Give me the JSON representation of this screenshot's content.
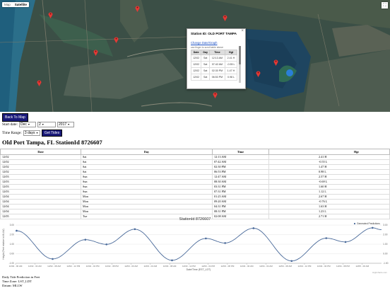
{
  "map": {
    "type_buttons": [
      "Map",
      "Satellite"
    ],
    "selected_type": "Satellite",
    "popup": {
      "title": "Station ID: OLD PORT TAMPA",
      "close": "×",
      "change_link": "Change Date/Graph",
      "hint": "use finger to scroll table above",
      "headers": [
        "Date",
        "Day",
        "Time",
        "Hgt"
      ],
      "rows": [
        [
          "12/02",
          "Sat",
          "12:13 AM",
          "2.41 H"
        ],
        [
          "12/02",
          "Sat",
          "07:42 AM",
          "-0.55 L"
        ],
        [
          "12/02",
          "Sat",
          "02:30 PM",
          "1.47 H"
        ],
        [
          "12/02",
          "Sat",
          "06:53 PM",
          "0.98 L"
        ]
      ]
    }
  },
  "controls": {
    "back_label": "Back To Map",
    "start_label": "Start date:",
    "month": "Dec",
    "day": "2",
    "year": "2017",
    "range_label": "Time Range:",
    "range": "3 days",
    "get_label": "Get Tides"
  },
  "station_title": "Old Port Tampa, FL StationId 8726607",
  "tide_table": {
    "headers": [
      "Date",
      "Day",
      "Time",
      "Hgt"
    ],
    "rows": [
      [
        "12/02",
        "Sat",
        "12:13 AM",
        "2.41 H"
      ],
      [
        "12/02",
        "Sat",
        "07:42 AM",
        "-0.55 L"
      ],
      [
        "12/02",
        "Sat",
        "02:30 PM",
        "1.47 H"
      ],
      [
        "12/02",
        "Sat",
        "06:53 PM",
        "0.98 L"
      ],
      [
        "12/03",
        "Sun",
        "12:47 AM",
        "2.57 H"
      ],
      [
        "12/03",
        "Sun",
        "08:30 AM",
        "-0.69 L"
      ],
      [
        "12/03",
        "Sun",
        "03:31 PM",
        "1.60 H"
      ],
      [
        "12/03",
        "Sun",
        "07:31 PM",
        "1.12 L"
      ],
      [
        "12/04",
        "Mon",
        "01:25 AM",
        "2.67 H"
      ],
      [
        "12/04",
        "Mon",
        "09:20 AM",
        "-0.76 L"
      ],
      [
        "12/04",
        "Mon",
        "04:31 PM",
        "1.63 H"
      ],
      [
        "12/04",
        "Mon",
        "08:31 PM",
        "1.23 L"
      ],
      [
        "12/05",
        "Tue",
        "02:08 AM",
        "2.71 H"
      ]
    ]
  },
  "chart_data": {
    "type": "line",
    "title": "StationId 8726607",
    "xlabel": "Date/Time (EST_LDT)",
    "ylabel": "Height (Feet relative to MLLW)",
    "legend": "Generated Predictions",
    "legend_position": "top-right",
    "ylim": [
      -1,
      3
    ],
    "yticks": [
      "3.00",
      "2.00",
      "1.00",
      "0.00",
      "-1.00"
    ],
    "xticks": [
      "12/02 - 00 AM",
      "12/02 - 04 AM",
      "12/02 - 08 AM",
      "12/02 - 12 PM",
      "12/02 - 04 PM",
      "12/02 - 08 PM",
      "12/03 - 00 AM",
      "12/03 - 04 AM",
      "12/03 - 08 AM",
      "12/03 - 12 PM",
      "12/03 - 04 PM",
      "12/03 - 08 PM",
      "12/04 - 00 AM",
      "12/04 - 04 AM",
      "12/04 - 08 AM",
      "12/04 - 12 PM",
      "12/04 - 04 PM",
      "12/04 - 08 PM",
      "12/05 - 00 AM"
    ],
    "points": [
      {
        "x": 0.22,
        "y": 2.41
      },
      {
        "x": 7.7,
        "y": -0.55
      },
      {
        "x": 14.5,
        "y": 1.47
      },
      {
        "x": 18.88,
        "y": 0.98
      },
      {
        "x": 24.78,
        "y": 2.57
      },
      {
        "x": 32.5,
        "y": -0.69
      },
      {
        "x": 39.52,
        "y": 1.6
      },
      {
        "x": 43.52,
        "y": 1.12
      },
      {
        "x": 49.42,
        "y": 2.67
      },
      {
        "x": 57.33,
        "y": -0.76
      },
      {
        "x": 64.52,
        "y": 1.63
      },
      {
        "x": 68.52,
        "y": 1.23
      },
      {
        "x": 74.13,
        "y": 2.71
      }
    ],
    "xlim": [
      0,
      76
    ],
    "credit": "Highcharts.com",
    "color": "#4a6a9a"
  },
  "footer": {
    "line1": "Daily Tide Prediction in Feet",
    "line2": "Time Zone: LST_LDT",
    "line3": "Datum: MLLW"
  }
}
